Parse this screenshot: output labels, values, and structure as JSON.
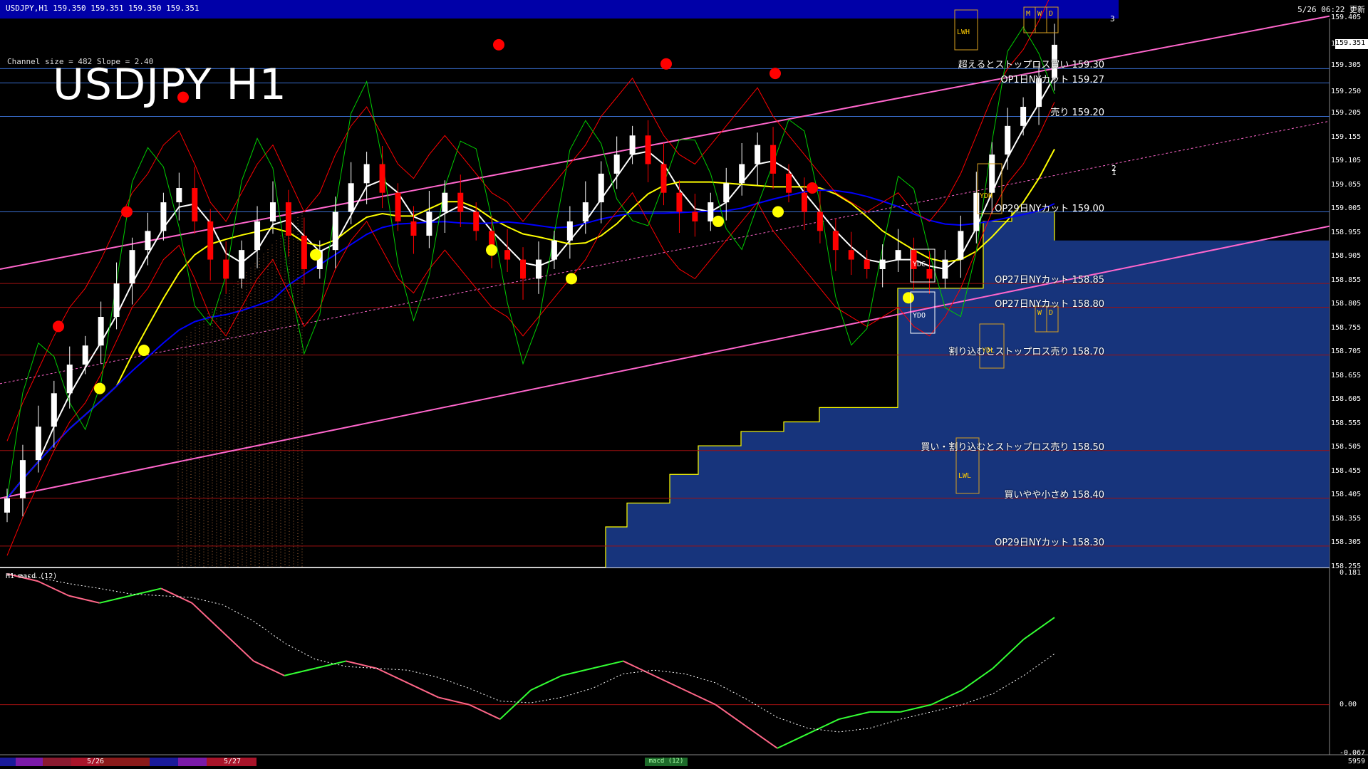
{
  "window": {
    "header_info": "USDJPY,H1  159.350 159.351 159.350 159.351",
    "datetime": "5/26 06:22 更新"
  },
  "chart_title": "USDJPY H1",
  "channel_info": "Channel size = 482 Slope = 2.40",
  "current_price": "159.351",
  "level_labels": [
    {
      "text": "超えるとストップロス買い 159.30",
      "price": 159.3
    },
    {
      "text": "OP1日NYカット 159.27",
      "price": 159.27
    },
    {
      "text": "売り 159.20",
      "price": 159.2
    },
    {
      "text": "OP29日NYカット 159.00",
      "price": 159.0
    },
    {
      "text": "OP27日NYカット 158.85",
      "price": 158.85
    },
    {
      "text": "OP27日NYカット 158.80",
      "price": 158.8
    },
    {
      "text": "割り込むとストップロス売り 158.70",
      "price": 158.7
    },
    {
      "text": "買い・割り込むとストップロス売り 158.50",
      "price": 158.5
    },
    {
      "text": "買いやや小さめ 158.40",
      "price": 158.4
    },
    {
      "text": "OP29日NYカット 158.30",
      "price": 158.3
    }
  ],
  "box_labels": [
    "LWH",
    "YDH",
    "YDC",
    "YDO",
    "YDL",
    "LWL",
    "M",
    "W",
    "D",
    "W",
    "D"
  ],
  "channel_counts": [
    "3",
    "2",
    "1"
  ],
  "macd": {
    "title": "H1  macd (12)",
    "axis": [
      "0.181",
      "0.00",
      "-0.067"
    ]
  },
  "bottom": {
    "dates": [
      "5/26",
      "5/27"
    ],
    "tab_label": "macd (12)",
    "right_value": "5959"
  },
  "colors": {
    "bull": "#ffffff",
    "bear": "#ff0000",
    "ma_short": "#ffffff",
    "ma_mid": "#ffff00",
    "ma_long": "#0000ff",
    "channel": "#ff66cc",
    "cloud_top": "#ffff00",
    "cloud_fill": "#1a3a8a",
    "envelope": "#ff0000",
    "green_line": "#00cc00",
    "macd_pos": "#33ff33",
    "macd_neg": "#ff6688"
  },
  "chart_data": {
    "type": "candlestick",
    "symbol": "USDJPY",
    "timeframe": "H1",
    "ylim": [
      158.255,
      159.405
    ],
    "y_ticks": [
      159.405,
      159.35,
      159.305,
      159.25,
      159.205,
      159.155,
      159.105,
      159.055,
      159.005,
      158.955,
      158.905,
      158.855,
      158.805,
      158.755,
      158.705,
      158.655,
      158.605,
      158.555,
      158.505,
      158.455,
      158.405,
      158.355,
      158.305,
      158.255
    ],
    "horizontal_levels": [
      159.3,
      159.27,
      159.2,
      159.0,
      158.85,
      158.8,
      158.7,
      158.5,
      158.4,
      158.3
    ],
    "close_series": [
      158.4,
      158.48,
      158.55,
      158.62,
      158.68,
      158.72,
      158.78,
      158.85,
      158.92,
      158.96,
      159.02,
      159.05,
      158.98,
      158.9,
      158.86,
      158.92,
      158.98,
      159.02,
      158.95,
      158.88,
      158.92,
      159.0,
      159.06,
      159.1,
      159.04,
      158.98,
      158.95,
      159.0,
      159.04,
      159.0,
      158.96,
      158.92,
      158.9,
      158.86,
      158.9,
      158.94,
      158.98,
      159.02,
      159.08,
      159.12,
      159.16,
      159.1,
      159.04,
      159.0,
      158.98,
      159.02,
      159.06,
      159.1,
      159.14,
      159.08,
      159.04,
      159.0,
      158.96,
      158.92,
      158.9,
      158.88,
      158.9,
      158.92,
      158.88,
      158.86,
      158.9,
      158.96,
      159.04,
      159.12,
      159.18,
      159.22,
      159.28,
      159.35
    ],
    "macd_values": [
      0.18,
      0.17,
      0.15,
      0.14,
      0.15,
      0.16,
      0.14,
      0.1,
      0.06,
      0.04,
      0.05,
      0.06,
      0.05,
      0.03,
      0.01,
      0.0,
      -0.02,
      0.02,
      0.04,
      0.05,
      0.06,
      0.04,
      0.02,
      0.0,
      -0.03,
      -0.06,
      -0.04,
      -0.02,
      -0.01,
      -0.01,
      0.0,
      0.02,
      0.05,
      0.09,
      0.12
    ]
  }
}
